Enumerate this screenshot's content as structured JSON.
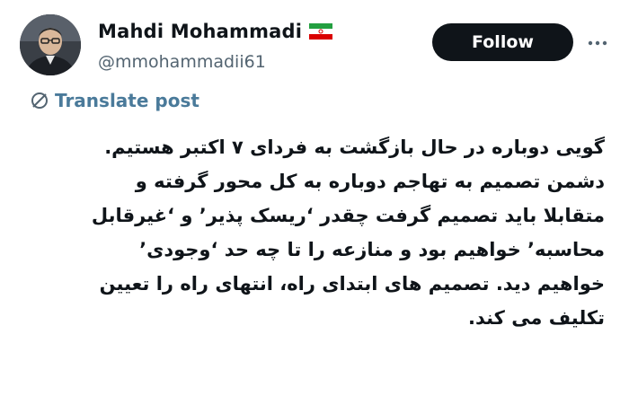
{
  "author": {
    "display_name": "Mahdi Mohammadi",
    "flag_icon": "iran-flag-icon",
    "handle": "@mmohammadii61",
    "avatar_icon": "profile-photo-avatar"
  },
  "actions": {
    "follow_label": "Follow",
    "more_icon": "more-options-icon"
  },
  "translate": {
    "icon": "globe-icon",
    "label": "Translate post"
  },
  "post": {
    "lines": [
      "گویی دوباره در حال بازگشت به فردای ۷ اکتبر هستیم.",
      "دشمن تصمیم به تهاجم دوباره به کل محور گرفته و",
      "متقابلا باید تصمیم گرفت چقدر ‘ریسک پذیر’ و ‘غیرقابل",
      "محاسبه’ خواهیم بود و منازعه را تا چه حد ‘وجودی’",
      "خواهیم دید. تصمیم های ابتدای راه، انتهای راه را تعیین",
      "تکلیف می کند."
    ]
  },
  "colors": {
    "follow_bg": "#0f1419",
    "handle": "#536471",
    "translate": "#4a7a9a"
  }
}
